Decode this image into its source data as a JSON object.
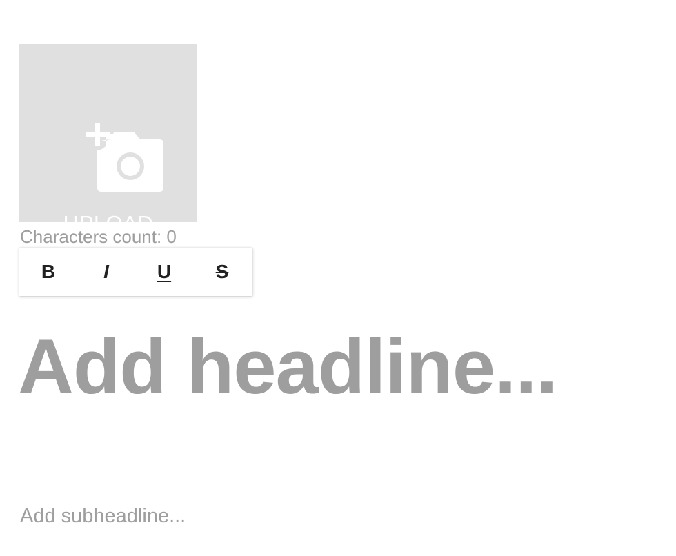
{
  "upload": {
    "label": "UPLOAD",
    "icon": "add-photo-icon"
  },
  "editor": {
    "char_count": "Characters count: 0",
    "toolbar": {
      "bold": "B",
      "italic": "I",
      "underline": "U",
      "strikethrough": "S"
    },
    "headline_placeholder": "Add headline...",
    "subheadline_placeholder": "Add subheadline..."
  },
  "colors": {
    "upload_bg": "#e0e0e0",
    "placeholder_text": "#9e9e9e",
    "toolbar_icon": "#212121"
  }
}
